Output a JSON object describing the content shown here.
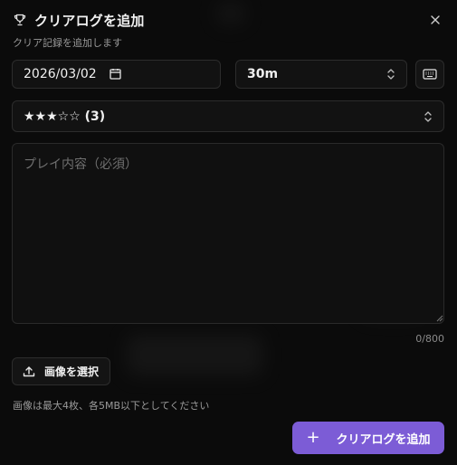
{
  "dialog": {
    "title": "クリアログを追加",
    "subtitle": "クリア記録を追加します"
  },
  "form": {
    "date_value": "2026/03/02",
    "duration_value": "30m",
    "rating_value": "★★★☆☆ (3)",
    "content_placeholder": "プレイ内容（必須）",
    "counter": "0/800",
    "upload_label": "画像を選択",
    "image_hint": "画像は最大4枚、各5MB以下としてください",
    "submit_label": "クリアログを追加",
    "submit_icon": "plus-icon"
  },
  "colors": {
    "accent": "#7c5cd6",
    "background": "#0b0b0b",
    "field_bg": "#121212",
    "border": "#2c2c2c"
  }
}
